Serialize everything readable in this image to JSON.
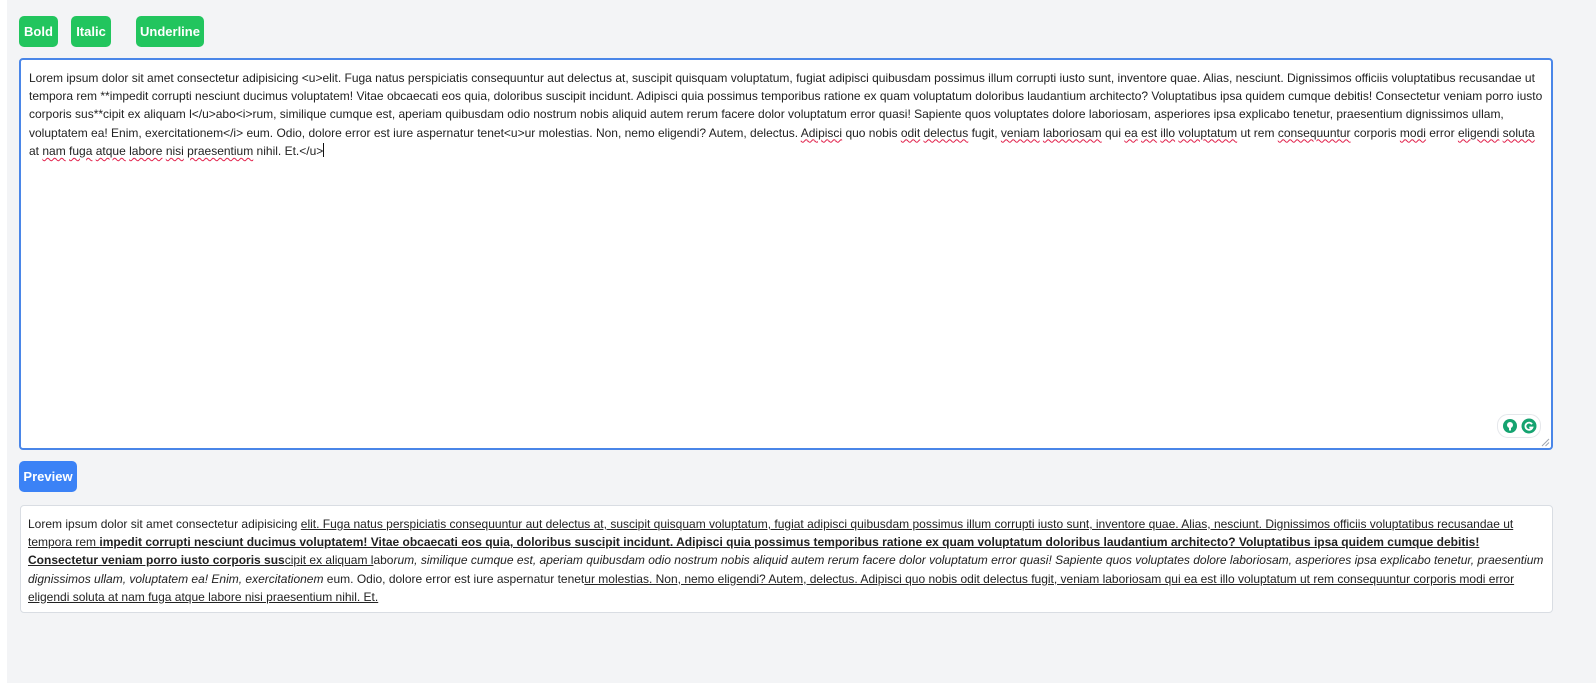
{
  "toolbar": {
    "bold_label": "Bold",
    "italic_label": "Italic",
    "underline_label": "Underline"
  },
  "editor": {
    "segments": [
      {
        "t": "Lorem ipsum dolor sit amet consectetur adipisicing <u>elit. Fuga natus perspiciatis consequuntur aut delectus at, suscipit quisquam voluptatum, fugiat adipisci quibusdam possimus illum corrupti iusto sunt, inventore quae. Alias, nesciunt. Dignissimos officiis voluptatibus recusandae ut tempora rem **impedit corrupti nesciunt ducimus voluptatem! Vitae obcaecati eos quia, doloribus suscipit incidunt. Adipisci quia possimus temporibus ratione ex quam voluptatum doloribus laudantium architecto? Voluptatibus ipsa quidem cumque debitis! Consectetur veniam porro iusto corporis sus**cipit ex aliquam l</u>abo<i>rum, similique cumque est, aperiam quibusdam odio nostrum nobis aliquid autem rerum facere dolor voluptatum error quasi! Sapiente quos voluptates dolore laboriosam, asperiores ipsa explicabo tenetur, praesentium dignissimos ullam, voluptatem ea! Enim, exercitationem</i> eum. Odio, dolore error est iure aspernatur tenet<u>ur molestias. Non, nemo eligendi? Autem, delectus. ",
        "s": ""
      },
      {
        "t": "Adipisci",
        "s": "spell"
      },
      {
        "t": " quo nobis ",
        "s": ""
      },
      {
        "t": "odit",
        "s": "spell"
      },
      {
        "t": " ",
        "s": ""
      },
      {
        "t": "delectus",
        "s": "spell"
      },
      {
        "t": " fugit, ",
        "s": ""
      },
      {
        "t": "veniam",
        "s": "spell"
      },
      {
        "t": " ",
        "s": ""
      },
      {
        "t": "laboriosam",
        "s": "spell"
      },
      {
        "t": " qui ",
        "s": ""
      },
      {
        "t": "ea",
        "s": "spell"
      },
      {
        "t": " ",
        "s": ""
      },
      {
        "t": "est",
        "s": "spell"
      },
      {
        "t": " ",
        "s": ""
      },
      {
        "t": "illo",
        "s": "spell"
      },
      {
        "t": " ",
        "s": ""
      },
      {
        "t": "voluptatum",
        "s": "spell"
      },
      {
        "t": " ut rem ",
        "s": ""
      },
      {
        "t": "consequuntur",
        "s": "spell"
      },
      {
        "t": " corporis ",
        "s": ""
      },
      {
        "t": "modi",
        "s": "spell"
      },
      {
        "t": " error ",
        "s": ""
      },
      {
        "t": "eligendi",
        "s": "spell"
      },
      {
        "t": " ",
        "s": ""
      },
      {
        "t": "soluta",
        "s": "spell"
      },
      {
        "t": " at ",
        "s": ""
      },
      {
        "t": "nam",
        "s": "spell"
      },
      {
        "t": " ",
        "s": ""
      },
      {
        "t": "fuga",
        "s": "spell"
      },
      {
        "t": " ",
        "s": ""
      },
      {
        "t": "atque",
        "s": "spell"
      },
      {
        "t": " ",
        "s": ""
      },
      {
        "t": "labore",
        "s": "spell"
      },
      {
        "t": " ",
        "s": ""
      },
      {
        "t": "nisi",
        "s": "spell"
      },
      {
        "t": " ",
        "s": ""
      },
      {
        "t": "praesentium",
        "s": "spell"
      },
      {
        "t": " nihil. Et.</u>",
        "s": ""
      }
    ]
  },
  "preview_button": {
    "label": "Preview"
  },
  "preview": {
    "segments": [
      {
        "t": "Lorem ipsum dolor sit amet consectetur adipisicing ",
        "s": ""
      },
      {
        "t": "elit. Fuga natus perspiciatis consequuntur aut delectus at, suscipit quisquam voluptatum, fugiat adipisci quibusdam possimus illum corrupti iusto sunt, inventore quae. Alias, nesciunt. Dignissimos officiis voluptatibus recusandae ut tempora rem ",
        "s": "u"
      },
      {
        "t": "impedit corrupti nesciunt ducimus voluptatem! Vitae obcaecati eos quia, doloribus suscipit incidunt. Adipisci quia possimus temporibus ratione ex quam voluptatum doloribus laudantium architecto? Voluptatibus ipsa quidem cumque debitis! Consectetur veniam porro iusto corporis sus",
        "s": "bu"
      },
      {
        "t": "cipit ex aliquam l",
        "s": "u"
      },
      {
        "t": "abo",
        "s": ""
      },
      {
        "t": "rum, similique cumque est, aperiam quibusdam odio nostrum nobis aliquid autem rerum facere dolor voluptatum error quasi! Sapiente quos voluptates dolore laboriosam, asperiores ipsa explicabo tenetur, praesentium dignissimos ullam, voluptatem ea! Enim, exercitationem",
        "s": "i"
      },
      {
        "t": " eum. Odio, dolore error est iure aspernatur tenet",
        "s": ""
      },
      {
        "t": "ur molestias. Non, nemo eligendi? Autem, delectus. Adipisci quo nobis odit delectus fugit, veniam laboriosam qui ea est illo voluptatum ut rem consequuntur corporis modi error eligendi soluta at nam fuga atque labore nisi praesentium nihil. Et.",
        "s": "u"
      }
    ]
  },
  "colors": {
    "page_bg": "#f3f4f6",
    "format_button": "#22c55e",
    "preview_button": "#3b82f6",
    "editor_focus_border": "#4a86e8",
    "spellcheck_underline": "#e11d48",
    "grammarly_green": "#15a370"
  },
  "icons": {
    "grammarly_logo": "grammarly-g-icon",
    "grammarly_assist": "bulb-icon",
    "resize_grip": "resize-grip-icon"
  }
}
